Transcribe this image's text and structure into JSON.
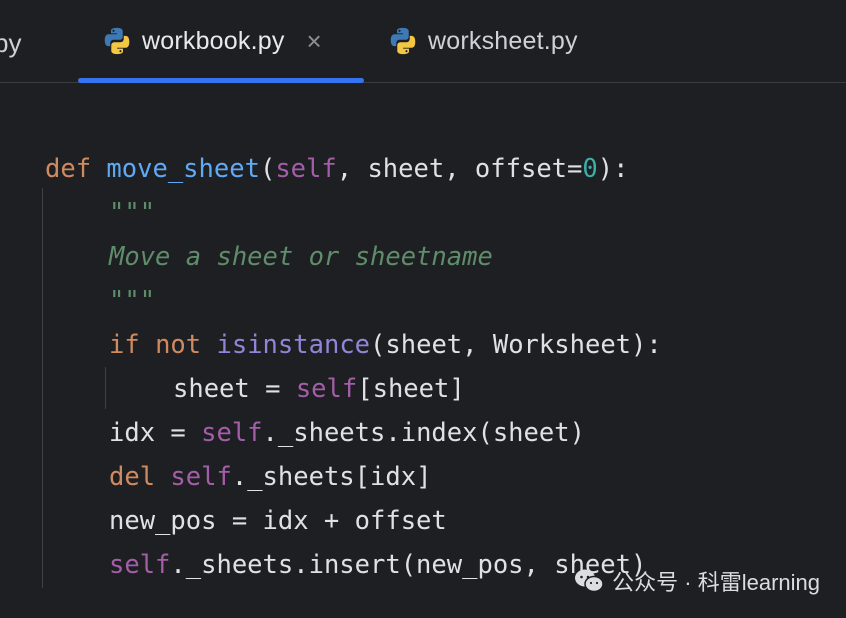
{
  "tabs": [
    {
      "label": "py",
      "state": "cut-off"
    },
    {
      "label": "workbook.py",
      "state": "active",
      "close_glyph": "×"
    },
    {
      "label": "worksheet.py",
      "state": "inactive"
    }
  ],
  "colors": {
    "background": "#1e1f22",
    "accent": "#3574f0",
    "keyword": "#d08a5f",
    "function": "#5fa9f5",
    "self": "#a45ea8",
    "number": "#3aaea7",
    "docstring": "#5f8c6a"
  },
  "code": {
    "l1": {
      "def": "def",
      "name": "move_sheet",
      "open": "(",
      "self": "self",
      "params": ", sheet, offset=",
      "num": "0",
      "close": "):"
    },
    "l2": {
      "doc": "\"\"\""
    },
    "l3": {
      "doc": "Move a sheet or sheetname"
    },
    "l4": {
      "doc": "\"\"\""
    },
    "l5": {
      "if": "if",
      "not": "not",
      "builtin": "isinstance",
      "rest": "(sheet, Worksheet):"
    },
    "l6": {
      "lhs": "sheet = ",
      "self": "self",
      "rest": "[sheet]"
    },
    "l7": {
      "lhs": "idx = ",
      "self": "self",
      "rest": "._sheets.index(sheet)"
    },
    "l8": {
      "del": "del",
      "self": "self",
      "rest": "._sheets[idx]"
    },
    "l9": {
      "text": "new_pos = idx + offset"
    },
    "l10": {
      "self": "self",
      "rest": "._sheets.insert(new_pos, sheet)"
    }
  },
  "watermark": {
    "text": "公众号 · 科雷learning",
    "icon": "wechat-icon"
  }
}
